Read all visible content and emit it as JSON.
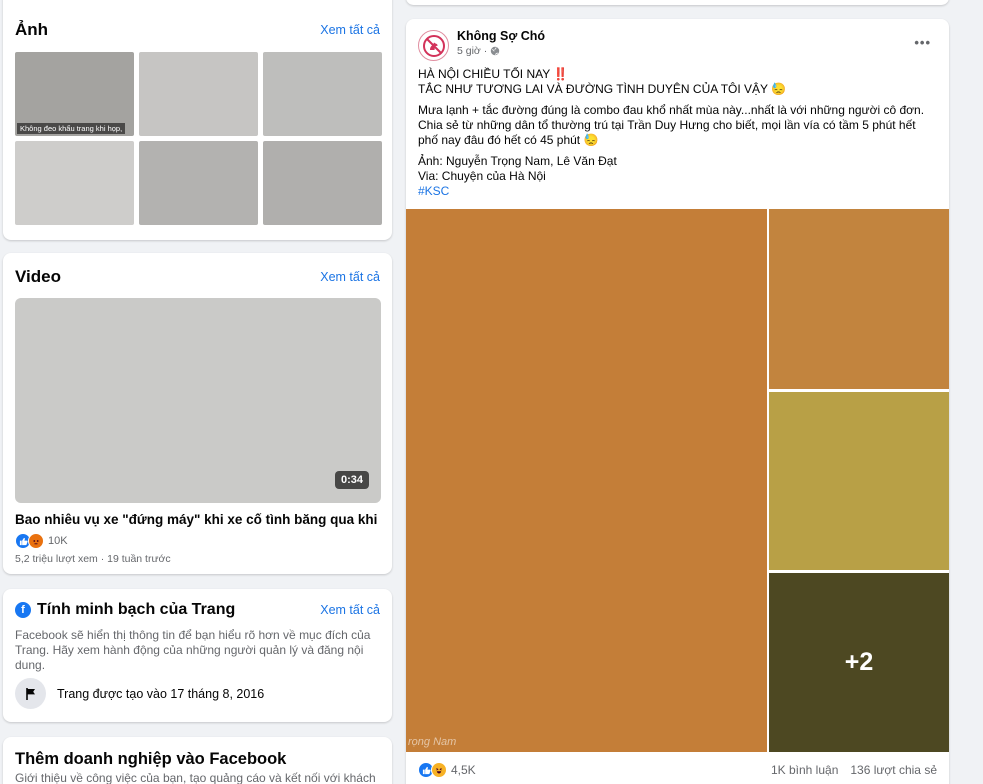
{
  "photos": {
    "title": "Ảnh",
    "see_all": "Xem tất cả",
    "caption": "Không đeo khẩu trang khi họp,"
  },
  "video": {
    "title": "Video",
    "see_all": "Xem tất cả",
    "duration": "0:34",
    "video_title": "Bao nhiêu vụ xe \"đứng máy\" khi xe cố tình băng qua khi ...",
    "reaction_count": "10K",
    "meta": "5,2 triệu lượt xem · 19 tuần trước"
  },
  "transparency": {
    "title": "Tính minh bạch của Trang",
    "see_all": "Xem tất cả",
    "description": "Facebook sẽ hiển thị thông tin để bạn hiểu rõ hơn về mục đích của Trang. Hãy xem hành động của những người quản lý và đăng nội dung.",
    "created": "Trang được tạo vào 17 tháng 8, 2016"
  },
  "business": {
    "title": "Thêm doanh nghiệp vào Facebook",
    "description": "Giới thiệu về công việc của bạn, tạo quảng cáo và kết nối với khách"
  },
  "post": {
    "author": "Không Sợ Chó",
    "time": "5 giờ ·",
    "more": "•••",
    "line1": "HÀ NỘI CHIỀU TỐI NAY ‼️",
    "line2": "TẮC NHƯ TƯƠNG LAI VÀ ĐƯỜNG TÌNH DUYÊN CỦA TÔI VẬY 😓",
    "line3": "Mưa lạnh + tắc đường đúng là combo đau khổ nhất mùa này...nhất là với những người cô đơn.",
    "line4": "Chia sẻ từ những dân tổ thường trú tại Trần Duy Hưng cho biết, mọi lần vía có tầm 5 phút hết",
    "line5": "phố nay đâu đó hết có 45 phút 😓",
    "line6": "Ảnh: Nguyễn Trọng Nam, Lê Văn Đạt",
    "line7": "Via: Chuyện của Hà Nội",
    "hashtag": "#KSC",
    "more_photos": "+2",
    "watermark": "rọng Nam",
    "reactions": "4,5K",
    "comments": "1K bình luận",
    "shares": "136 lượt chia sẻ"
  },
  "colors": {
    "link": "#1b74e4",
    "facebook_blue": "#1877f2",
    "like": "#1877f2",
    "haha": "#f7b125",
    "angry": "#e9710f"
  }
}
